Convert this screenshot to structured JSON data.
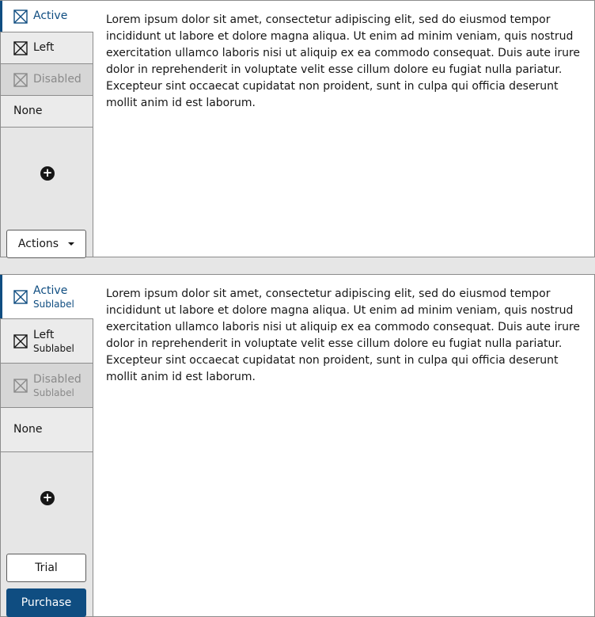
{
  "tabset_one": {
    "tabs": [
      {
        "label": "Active",
        "icon": "close-box-icon",
        "state": "active"
      },
      {
        "label": "Left",
        "icon": "close-box-icon",
        "state": "normal"
      },
      {
        "label": "Disabled",
        "icon": "close-box-icon",
        "state": "disabled"
      },
      {
        "label": "None",
        "state": "normal"
      }
    ],
    "add_icon": "plus-circle-icon",
    "actions_label": "Actions",
    "panel_text": "Lorem ipsum dolor sit amet, consectetur adipiscing elit, sed do eiusmod tempor incididunt ut labore et dolore magna aliqua. Ut enim ad minim veniam, quis nostrud exercitation ullamco laboris nisi ut aliquip ex ea commodo consequat. Duis aute irure dolor in reprehenderit in voluptate velit esse cillum dolore eu fugiat nulla pariatur. Excepteur sint occaecat cupidatat non proident, sunt in culpa qui officia deserunt mollit anim id est laborum."
  },
  "tabset_two": {
    "tabs": [
      {
        "label": "Active",
        "sublabel": "Sublabel",
        "icon": "close-box-icon",
        "state": "active"
      },
      {
        "label": "Left",
        "sublabel": "Sublabel",
        "icon": "close-box-icon",
        "state": "normal"
      },
      {
        "label": "Disabled",
        "sublabel": "Sublabel",
        "icon": "close-box-icon",
        "state": "disabled"
      },
      {
        "label": "None",
        "state": "normal"
      }
    ],
    "add_icon": "plus-circle-icon",
    "trial_label": "Trial",
    "purchase_label": "Purchase",
    "panel_text": "Lorem ipsum dolor sit amet, consectetur adipiscing elit, sed do eiusmod tempor incididunt ut labore et dolore magna aliqua. Ut enim ad minim veniam, quis nostrud exercitation ullamco laboris nisi ut aliquip ex ea commodo consequat. Duis aute irure dolor in reprehenderit in voluptate velit esse cillum dolore eu fugiat nulla pariatur. Excepteur sint occaecat cupidatat non proident, sunt in culpa qui officia deserunt mollit anim id est laborum."
  },
  "colors": {
    "accent": "#0f4d81",
    "border": "#8c8c8c",
    "tab_background": "#ebebeb",
    "disabled_background": "#d6d6d6",
    "disabled_text": "#8a8a8a"
  }
}
